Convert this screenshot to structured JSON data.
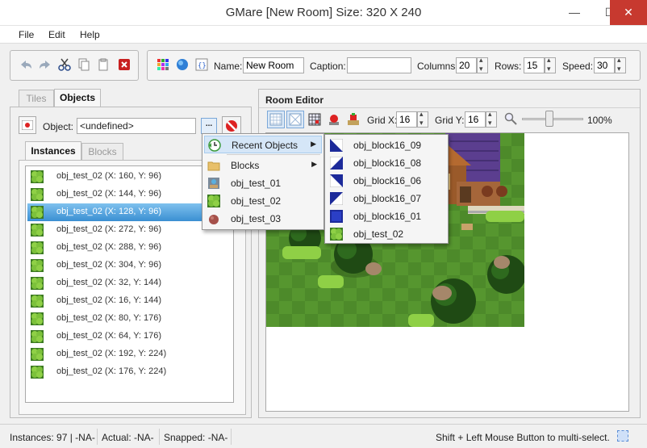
{
  "window": {
    "title": "GMare [New Room] Size: 320 X 240"
  },
  "menubar": [
    "File",
    "Edit",
    "Help"
  ],
  "toolbar": {
    "name_label": "Name:",
    "name_value": "New Room",
    "caption_label": "Caption:",
    "caption_value": "",
    "columns_label": "Columns:",
    "columns_value": "20",
    "rows_label": "Rows:",
    "rows_value": "15",
    "speed_label": "Speed:",
    "speed_value": "30"
  },
  "left": {
    "tabs": [
      "Tiles",
      "Objects"
    ],
    "active_tab": "Objects",
    "object_label": "Object:",
    "object_value": "<undefined>",
    "browse_label": "...",
    "subtabs": [
      "Instances",
      "Blocks"
    ],
    "instances": [
      "obj_test_02 (X: 160, Y: 96)",
      "obj_test_02 (X: 144, Y: 96)",
      "obj_test_02 (X: 128, Y: 96)",
      "obj_test_02 (X: 272, Y: 96)",
      "obj_test_02 (X: 288, Y: 96)",
      "obj_test_02 (X: 304, Y: 96)",
      "obj_test_02 (X: 32, Y: 144)",
      "obj_test_02 (X: 16, Y: 144)",
      "obj_test_02 (X: 80, Y: 176)",
      "obj_test_02 (X: 64, Y: 176)",
      "obj_test_02 (X: 192, Y: 224)",
      "obj_test_02 (X: 176, Y: 224)"
    ],
    "selected_index": 2
  },
  "room_editor": {
    "title": "Room Editor",
    "grid_x_label": "Grid X:",
    "grid_x_value": "16",
    "grid_y_label": "Grid Y:",
    "grid_y_value": "16",
    "zoom_percent": 100,
    "zoom_text": "100%"
  },
  "popup_main": {
    "items": [
      {
        "label": "Recent Objects",
        "submenu": true,
        "icon": "recent-icon"
      },
      {
        "label": "Blocks",
        "submenu": true,
        "icon": "folder-icon"
      },
      {
        "label": "obj_test_01",
        "submenu": false,
        "icon": "object-test01-icon"
      },
      {
        "label": "obj_test_02",
        "submenu": false,
        "icon": "bush-icon"
      },
      {
        "label": "obj_test_03",
        "submenu": false,
        "icon": "rock-icon"
      }
    ]
  },
  "popup_recent": {
    "items": [
      {
        "label": "obj_block16_09",
        "icon": "block-triangle-icon"
      },
      {
        "label": "obj_block16_08",
        "icon": "block-triangle-icon"
      },
      {
        "label": "obj_block16_06",
        "icon": "block-triangle-icon"
      },
      {
        "label": "obj_block16_07",
        "icon": "block-triangle-icon"
      },
      {
        "label": "obj_block16_01",
        "icon": "block-square-icon"
      },
      {
        "label": "obj_test_02",
        "icon": "bush-icon"
      }
    ]
  },
  "status": {
    "instances": "Instances: 97 | -NA-",
    "actual": "Actual: -NA-",
    "snapped": "Snapped: -NA-",
    "hint": "Shift + Left Mouse Button to multi-select."
  },
  "colors": {
    "selection": "#3a8fd2",
    "close": "#c7392f",
    "grass": "#4e8f2a",
    "block": "#1c2a9a"
  }
}
